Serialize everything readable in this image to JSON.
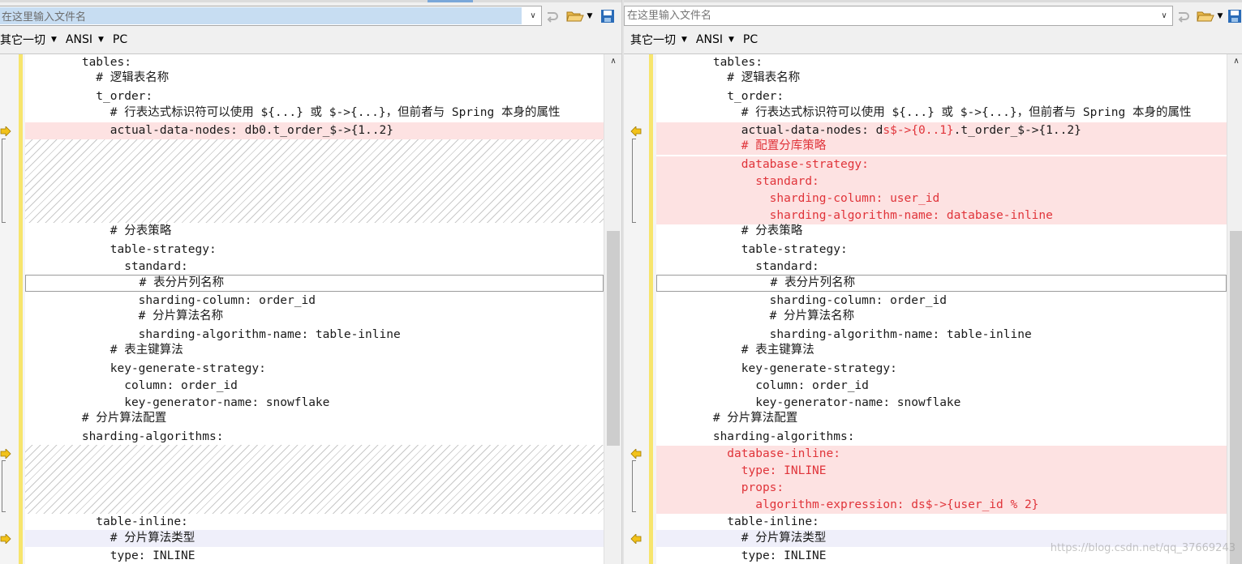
{
  "left": {
    "path": {
      "value": "在这里输入文件名",
      "placeholder": "在这里输入文件名"
    },
    "format": {
      "charset_filter": "其它一切",
      "encoding": "ANSI",
      "line_ending": "PC"
    },
    "lines": [
      "        tables:",
      "          # 逻辑表名称",
      "          t_order:",
      "            # 行表达式标识符可以使用 ${...} 或 $->{...}，但前者与 Spring 本身的属性",
      "            actual-data-nodes: db0.t_order_$->{1..2}",
      "            # 分表策略",
      "            table-strategy:",
      "              standard:",
      "                # 表分片列名称",
      "                sharding-column: order_id",
      "                # 分片算法名称",
      "                sharding-algorithm-name: table-inline",
      "            # 表主键算法",
      "            key-generate-strategy:",
      "              column: order_id",
      "              key-generator-name: snowflake",
      "        # 分片算法配置",
      "        sharding-algorithms:",
      "          table-inline:",
      "            # 分片算法类型",
      "            type: INLINE"
    ]
  },
  "right": {
    "path": {
      "value": "",
      "placeholder": "在这里输入文件名"
    },
    "format": {
      "charset_filter": "其它一切",
      "encoding": "ANSI",
      "line_ending": "PC"
    },
    "lines": [
      "        tables:",
      "          # 逻辑表名称",
      "          t_order:",
      "            # 行表达式标识符可以使用 ${...} 或 $->{...}，但前者与 Spring 本身的属性",
      "            actual-data-nodes: ds$->{0..1}.t_order_$->{1..2}",
      "            # 配置分库策略",
      "            database-strategy:",
      "              standard:",
      "                sharding-column: user_id",
      "                sharding-algorithm-name: database-inline",
      "            # 分表策略",
      "            table-strategy:",
      "              standard:",
      "                # 表分片列名称",
      "                sharding-column: order_id",
      "                # 分片算法名称",
      "                sharding-algorithm-name: table-inline",
      "            # 表主键算法",
      "            key-generate-strategy:",
      "              column: order_id",
      "              key-generator-name: snowflake",
      "        # 分片算法配置",
      "        sharding-algorithms:",
      "          database-inline:",
      "            type: INLINE",
      "            props:",
      "              algorithm-expression: ds$->{user_id % 2}",
      "          table-inline:",
      "            # 分片算法类型",
      "            type: INLINE"
    ]
  },
  "watermark": "https://blog.csdn.net/qq_37669243",
  "colors": {
    "added_text": "#e0343a",
    "diff_background": "#fde2e2",
    "current_line": "#efeffa",
    "gutter_bar": "#f7e56c"
  }
}
